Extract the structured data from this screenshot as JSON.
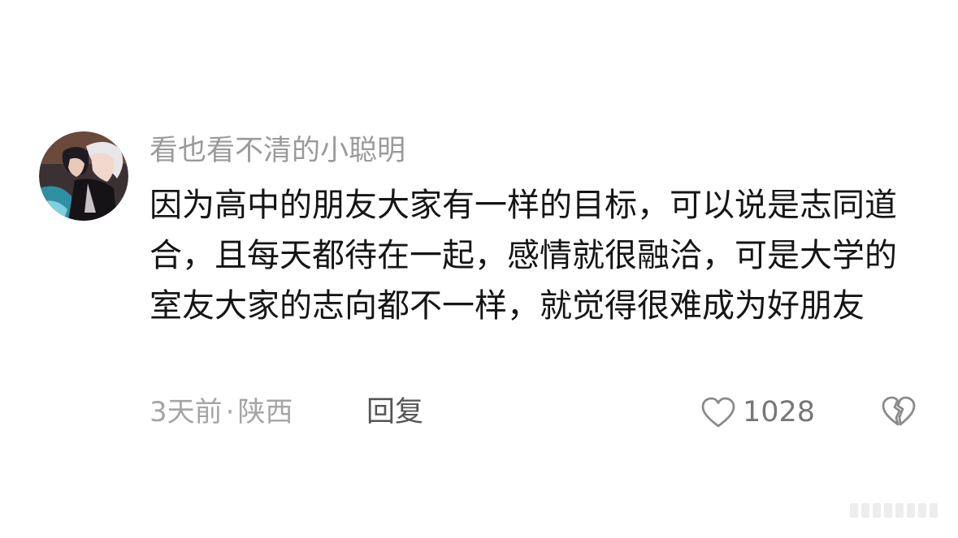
{
  "comment": {
    "username": "看也看不清的小聪明",
    "text": "因为高中的朋友大家有一样的目标，可以说是志同道合，且每天都待在一起，感情就很融洽，可是大学的室友大家的志向都不一样，就觉得很难成为好朋友",
    "time": "3天前",
    "separator": "·",
    "location": "陕西",
    "reply_label": "回复",
    "like_count": "1028",
    "avatar_icon": "anime-avatar",
    "like_icon": "heart-outline-icon",
    "dislike_icon": "broken-heart-icon"
  }
}
